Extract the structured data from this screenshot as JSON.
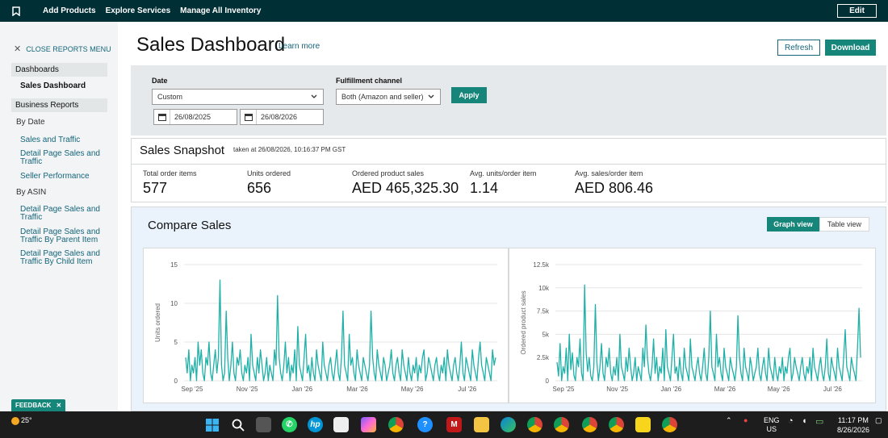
{
  "topnav": {
    "links": [
      "Add Products",
      "Explore Services",
      "Manage All Inventory"
    ],
    "edit_label": "Edit"
  },
  "sidebar": {
    "close_label": "CLOSE REPORTS MENU",
    "dashboards_heading": "Dashboards",
    "active_item": "Sales Dashboard",
    "business_heading": "Business Reports",
    "by_date": "By Date",
    "date_items": [
      "Sales and Traffic",
      "Detail Page Sales and Traffic",
      "Seller Performance"
    ],
    "by_asin": "By ASIN",
    "asin_items": [
      "Detail Page Sales and Traffic",
      "Detail Page Sales and Traffic By Parent Item",
      "Detail Page Sales and Traffic By Child Item"
    ],
    "feedback_label": "FEEDBACK"
  },
  "main": {
    "title": "Sales Dashboard",
    "learn_more": "Learn more",
    "refresh_label": "Refresh",
    "download_label": "Download"
  },
  "filters": {
    "date_label": "Date",
    "date_value": "Custom",
    "start_date": "26/08/2025",
    "end_date": "26/08/2026",
    "channel_label": "Fulfillment channel",
    "channel_value": "Both (Amazon and seller)",
    "apply_label": "Apply"
  },
  "snapshot": {
    "title": "Sales Snapshot",
    "taken": "taken at 26/08/2026, 10:16:37 PM GST",
    "metrics": [
      {
        "label": "Total order items",
        "value": "577"
      },
      {
        "label": "Units ordered",
        "value": "656"
      },
      {
        "label": "Ordered product sales",
        "value": "AED 465,325.30"
      },
      {
        "label": "Avg. units/order item",
        "value": "1.14"
      },
      {
        "label": "Avg. sales/order item",
        "value": "AED 806.46"
      }
    ]
  },
  "compare": {
    "title": "Compare Sales",
    "graph_view": "Graph view",
    "table_view": "Table view"
  },
  "chart_data": [
    {
      "type": "line",
      "ylabel": "Units ordered",
      "xlabel": "",
      "x_ticks": [
        "Sep '25",
        "Nov '25",
        "Jan '26",
        "Mar '26",
        "May '26",
        "Jul '26"
      ],
      "y_ticks": [
        "0",
        "5",
        "10",
        "15"
      ],
      "ylim": [
        0,
        15
      ],
      "color": "#1fb0a8",
      "values": [
        3,
        1,
        4,
        0,
        2,
        1,
        3,
        0,
        5,
        2,
        4,
        1,
        0,
        3,
        2,
        5,
        1,
        0,
        2,
        4,
        1,
        3,
        13,
        2,
        0,
        1,
        9,
        3,
        0,
        2,
        5,
        1,
        0,
        3,
        2,
        4,
        1,
        0,
        2,
        1,
        3,
        0,
        6,
        2,
        1,
        0,
        3,
        1,
        4,
        2,
        0,
        1,
        3,
        0,
        2,
        1,
        0,
        4,
        2,
        11,
        3,
        1,
        0,
        2,
        5,
        1,
        3,
        0,
        2,
        1,
        4,
        0,
        7,
        2,
        1,
        0,
        3,
        6,
        1,
        2,
        0,
        3,
        1,
        0,
        4,
        2,
        1,
        0,
        5,
        2,
        1,
        0,
        2,
        3,
        1,
        0,
        2,
        4,
        1,
        0,
        3,
        9,
        2,
        1,
        0,
        6,
        2,
        3,
        1,
        0,
        4,
        2,
        1,
        0,
        3,
        2,
        1,
        0,
        2,
        9,
        3,
        1,
        0,
        4,
        2,
        1,
        0,
        3,
        2,
        0,
        1,
        2,
        4,
        1,
        0,
        2,
        3,
        1,
        0,
        4,
        2,
        1,
        0,
        3,
        1,
        0,
        2,
        1,
        3,
        0,
        2,
        1,
        3,
        4,
        0,
        1,
        3,
        2,
        1,
        0,
        2,
        3,
        1,
        0,
        2,
        1,
        3,
        0,
        4,
        2,
        1,
        0,
        2,
        3,
        1,
        0,
        2,
        5,
        1,
        0,
        3,
        2,
        1,
        0,
        4,
        2,
        1,
        0,
        3,
        5,
        2,
        1,
        0,
        3,
        2,
        1,
        0,
        4,
        2,
        3
      ]
    },
    {
      "type": "line",
      "ylabel": "Ordered product sales",
      "xlabel": "",
      "x_ticks": [
        "Sep '25",
        "Nov '25",
        "Jan '26",
        "Mar '26",
        "May '26",
        "Jul '26"
      ],
      "y_ticks": [
        "0",
        "2.5k",
        "5k",
        "7.5k",
        "10k",
        "12.5k"
      ],
      "ylim": [
        0,
        12500
      ],
      "color": "#1fb0a8",
      "values": [
        2000,
        500,
        4000,
        0,
        1500,
        800,
        3500,
        0,
        5000,
        1200,
        3000,
        600,
        0,
        2500,
        1500,
        4500,
        800,
        0,
        10300,
        3000,
        1000,
        2500,
        500,
        0,
        1500,
        8200,
        2000,
        0,
        1500,
        4000,
        800,
        0,
        2500,
        1500,
        3500,
        800,
        0,
        1500,
        600,
        2500,
        0,
        5000,
        1500,
        800,
        0,
        2500,
        1000,
        3500,
        1500,
        0,
        800,
        2500,
        0,
        1500,
        800,
        0,
        3500,
        1500,
        6000,
        2500,
        800,
        0,
        1500,
        4500,
        800,
        2500,
        0,
        1500,
        800,
        3500,
        0,
        5500,
        1500,
        800,
        0,
        2500,
        5000,
        800,
        1500,
        0,
        2500,
        800,
        0,
        3500,
        1500,
        800,
        0,
        4500,
        1500,
        800,
        0,
        1500,
        2500,
        800,
        0,
        1500,
        3500,
        800,
        0,
        2500,
        7500,
        1500,
        800,
        0,
        5000,
        1500,
        2500,
        800,
        0,
        3500,
        1500,
        800,
        0,
        2500,
        1500,
        800,
        0,
        1500,
        7000,
        2500,
        800,
        0,
        3500,
        1500,
        800,
        0,
        2500,
        1500,
        0,
        800,
        1500,
        3500,
        800,
        0,
        1500,
        2500,
        800,
        0,
        3500,
        1500,
        800,
        0,
        2500,
        800,
        0,
        1500,
        800,
        2500,
        0,
        1500,
        800,
        2500,
        3500,
        0,
        800,
        2500,
        1500,
        800,
        0,
        1500,
        2500,
        800,
        0,
        1500,
        800,
        2500,
        0,
        3500,
        1500,
        800,
        0,
        1500,
        2500,
        800,
        0,
        1500,
        4500,
        800,
        0,
        2500,
        1500,
        800,
        0,
        3500,
        1500,
        800,
        0,
        2500,
        5500,
        1500,
        800,
        0,
        2500,
        1500,
        800,
        0,
        3500,
        7800,
        2500
      ]
    }
  ],
  "taskbar": {
    "temp": "25°",
    "lang": "ENG",
    "region": "US",
    "time": "11:17 PM",
    "date": "8/26/2026"
  }
}
